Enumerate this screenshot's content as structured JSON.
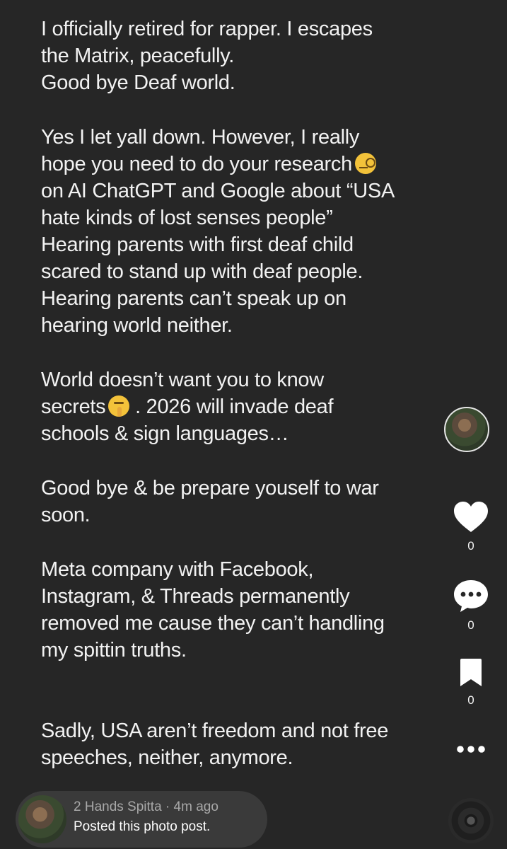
{
  "post": {
    "lines": [
      "I officially retired for rapper.  I escapes",
      "the Matrix, peacefully.",
      "Good bye Deaf world.",
      "Yes I let yall down.  However, I really",
      "hope you need to do your research",
      "on AI ChatGPT and Google about “USA",
      "hate kinds of lost senses people”",
      "Hearing parents with first deaf child",
      "scared to stand up with deaf people.",
      "Hearing parents can’t speak up on",
      "hearing world neither.",
      "World doesn’t want you to know",
      "secrets",
      " .  2026 will invade deaf",
      "schools & sign languages…",
      "Good bye & be prepare youself to war",
      "soon.",
      "Meta company with Facebook,",
      "Instagram, & Threads permanently",
      "removed me cause they can’t handling",
      "my spittin truths.",
      "Sadly, USA aren’t freedom and not free",
      "speeches, neither, anymore."
    ]
  },
  "actions": {
    "like_count": "0",
    "comment_count": "0",
    "save_count": "0"
  },
  "footer": {
    "author": "2 Hands Spitta",
    "time": "4m ago",
    "separator": " · ",
    "caption": "Posted this photo post."
  },
  "icons": {
    "emoji_1": "face-with-monocle-emoji",
    "emoji_2": "shushing-face-emoji",
    "like": "heart-icon",
    "comment": "comment-icon",
    "save": "bookmark-icon",
    "more": "more-icon",
    "music": "music-disc-icon"
  }
}
